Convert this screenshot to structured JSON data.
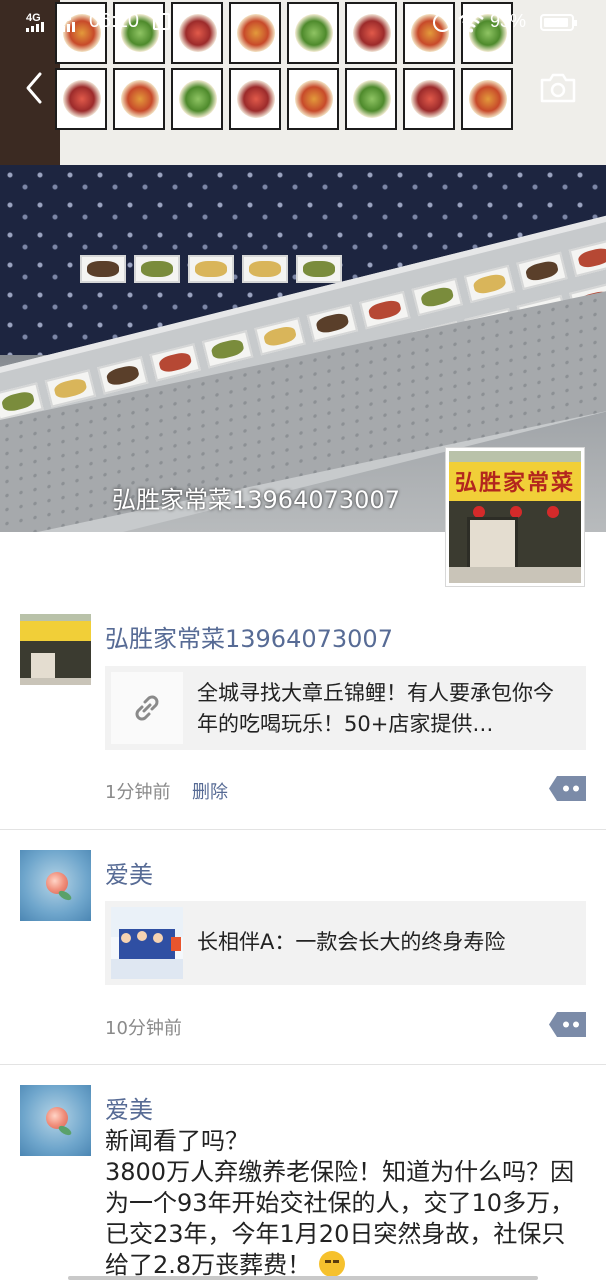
{
  "status_bar": {
    "signal_1": "4G",
    "signal_2": "4G",
    "time": "06:10",
    "battery_percent": "93%",
    "battery_level": 0.93
  },
  "header": {
    "back_icon": "chevron-left-icon",
    "camera_icon": "camera-icon"
  },
  "cover": {
    "name": "弘胜家常菜13964073007",
    "store_sign": "弘胜家常菜"
  },
  "posts": [
    {
      "author": "弘胜家常菜13964073007",
      "link_title": "全城寻找大章丘锦鲤！有人要承包你今年的吃喝玩乐！50+店家提供…",
      "link_icon": "link-icon",
      "time": "1分钟前",
      "delete_label": "删除"
    },
    {
      "author": "爱美",
      "link_title": "长相伴A：一款会长大的终身寿险",
      "time": "10分钟前"
    },
    {
      "author": "爱美",
      "text_line_1": "新闻看了吗？",
      "text_line_2": "3800万人弃缴养老保险！知道为什么吗？因为一个93年开始交社保的人，交了10多万，已交23年，今年1月20日突然身故，社保只给了2.8万丧葬费！"
    }
  ],
  "colors": {
    "nickname": "#576b95",
    "meta": "#8a8a8a",
    "card_bg": "#f2f2f2",
    "more_button": "#7b8ba8"
  }
}
